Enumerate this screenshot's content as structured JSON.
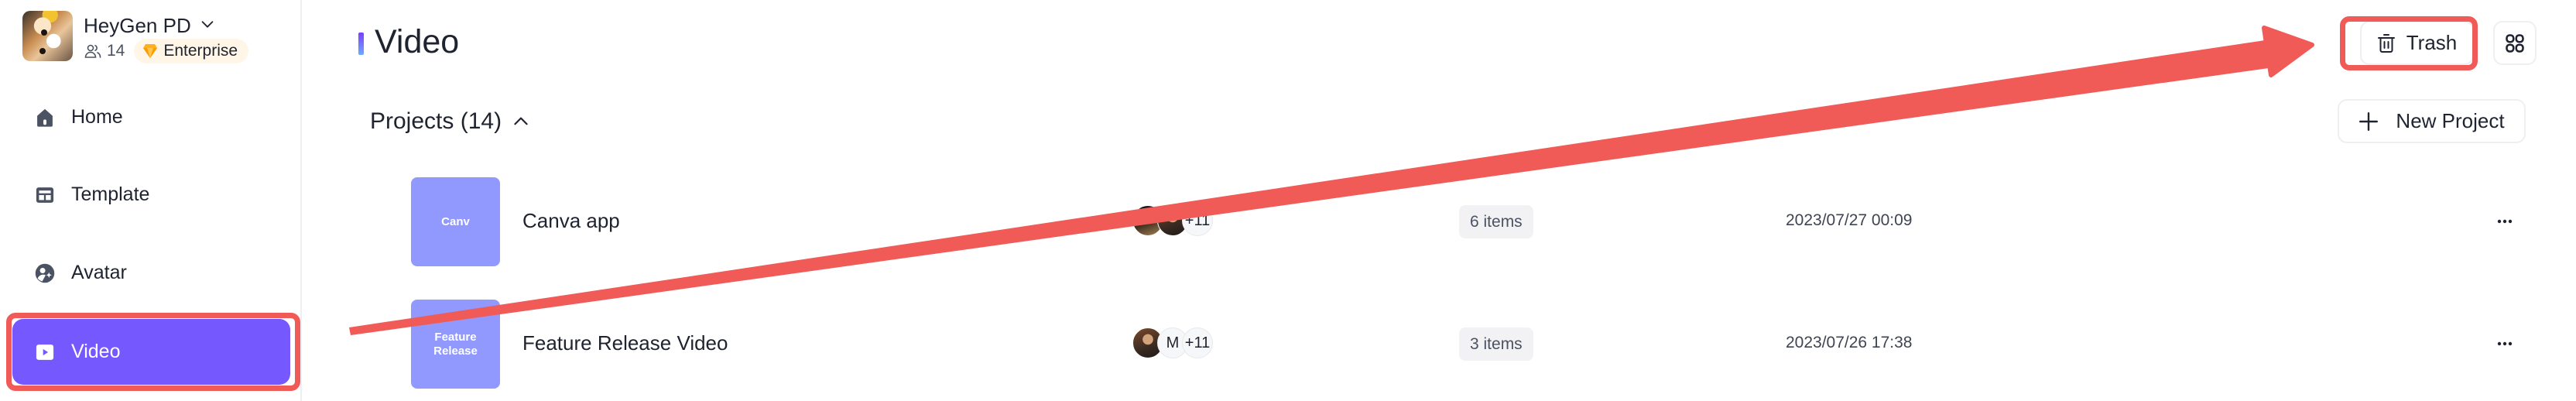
{
  "team": {
    "name": "HeyGen PD",
    "member_count": "14",
    "plan": "Enterprise"
  },
  "sidebar": {
    "items": [
      {
        "label": "Home",
        "icon": "home-icon",
        "active": false
      },
      {
        "label": "Template",
        "icon": "template-icon",
        "active": false
      },
      {
        "label": "Avatar",
        "icon": "avatar-icon",
        "active": false
      },
      {
        "label": "Video",
        "icon": "video-icon",
        "active": true
      }
    ]
  },
  "header": {
    "title": "Video",
    "trash_label": "Trash",
    "grid_view": "grid-view-icon"
  },
  "projects": {
    "heading": "Projects (14)",
    "new_project_label": "New Project",
    "rows": [
      {
        "thumb_text": "Canv",
        "name": "Canva app",
        "members": [
          "photo",
          "photo",
          "+11"
        ],
        "items": "6 items",
        "updated": "2023/07/27 00:09"
      },
      {
        "thumb_text": "Feature Release",
        "name": "Feature Release Video",
        "members": [
          "photo",
          "M",
          "+11"
        ],
        "items": "3 items",
        "updated": "2023/07/26 17:38"
      }
    ]
  },
  "colors": {
    "accent": "#7559FF",
    "thumbnail": "#9199FE",
    "annotation": "#F05B57",
    "plan_badge_bg": "#FFF6E8"
  },
  "annotation": {
    "description": "Red arrow from the Video nav item pointing to the Trash button; both highlighted with red boxes"
  }
}
